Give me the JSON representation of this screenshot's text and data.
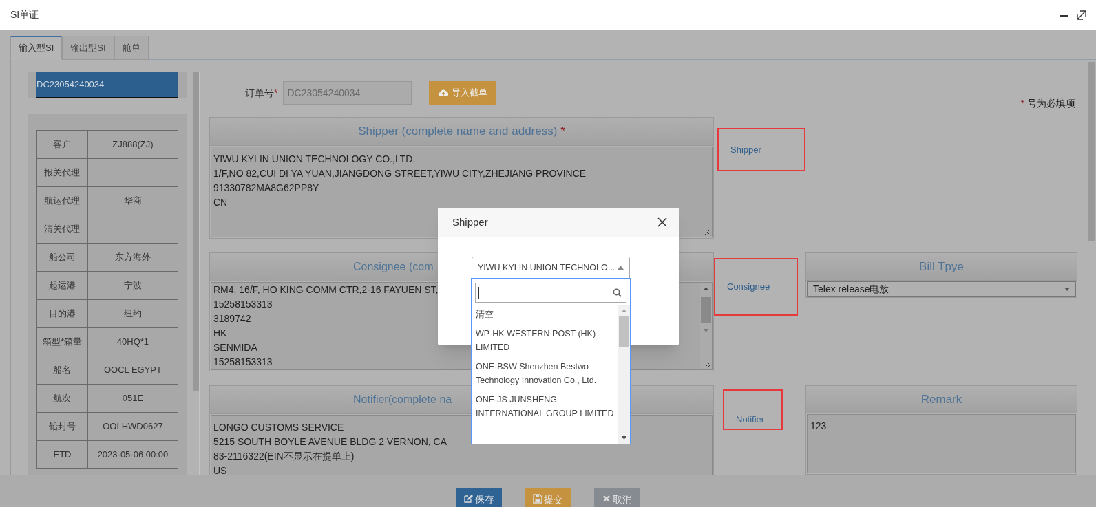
{
  "window": {
    "title": "SI单证"
  },
  "tabs": [
    {
      "label": "输入型SI",
      "selected": true
    },
    {
      "label": "输出型SI",
      "selected": false
    },
    {
      "label": "舱单",
      "selected": false
    }
  ],
  "order_list": [
    {
      "label": "DC23054240034",
      "selected": true
    }
  ],
  "info_table": {
    "rows": [
      {
        "label": "客户",
        "value": "ZJ888(ZJ)"
      },
      {
        "label": "报关代理"
      },
      {
        "label": "航运代理",
        "value": "华商"
      },
      {
        "label": "清关代理"
      },
      {
        "label": "船公司",
        "value": "东方海外"
      },
      {
        "label": "起运港",
        "value": "宁波"
      },
      {
        "label": "目的港",
        "value": "纽约"
      },
      {
        "label": "箱型*箱量",
        "value": "40HQ*1"
      },
      {
        "label": "船名",
        "value": "OOCL EGYPT"
      },
      {
        "label": "航次",
        "value": "051E"
      },
      {
        "label": "铅封号",
        "value": "OOLHWD0627"
      },
      {
        "label": "ETD",
        "value": "2023-05-06 00:00"
      }
    ]
  },
  "order_no": {
    "label": "订单号",
    "mark": "*",
    "value": "DC23054240034"
  },
  "import_button": {
    "label": "导入截单"
  },
  "required_note": {
    "mark": "*",
    "text": "号为必填项"
  },
  "sections": [
    {
      "title": "Shipper (complete name and address)",
      "mark": "*",
      "cut": false,
      "lines": [
        "YIWU KYLIN UNION TECHNOLOGY CO.,LTD.",
        "1/F,NO 82,CUI DI YA YUAN,JIANGDONG STREET,YIWU CITY,ZHEJIANG PROVINCE",
        "91330782MA8G62PP8Y",
        "CN"
      ],
      "scrollbar": false,
      "annotation": "Shipper"
    },
    {
      "title": "Consignee (com",
      "cut": true,
      "lines": [
        "RM4, 16/F, HO KING COMM CTR,2-16 FAYUEN ST,",
        "15258153313",
        "3189742",
        "HK",
        "SENMIDA",
        "15258153313"
      ],
      "scrollbar": true,
      "annotation": "Consignee"
    },
    {
      "title": "Notifier(complete na",
      "cut": true,
      "lines": [
        "LONGO CUSTOMS SERVICE",
        "5215 SOUTH BOYLE AVENUE BLDG 2 VERNON, CA",
        "83-2116322(EIN不显示在提单上)",
        "US"
      ],
      "scrollbar": false,
      "annotation": "Notifier"
    }
  ],
  "bill_type": {
    "title": "Bill Tpye",
    "value": "Telex release电放"
  },
  "remark": {
    "title": "Remark",
    "value": "123"
  },
  "footer_buttons": [
    {
      "label": "保存",
      "kind": "save"
    },
    {
      "label": "提交",
      "kind": "submit"
    },
    {
      "label": "取消",
      "kind": "cancel"
    }
  ],
  "dialog": {
    "title": "Shipper",
    "select": {
      "value": "YIWU KYLIN UNION TECHNOLO...",
      "expanded": true
    },
    "options": [
      {
        "label": "清空"
      },
      {
        "label": "WP-HK WESTERN POST (HK) LIMITED"
      },
      {
        "label": "ONE-BSW Shenzhen Bestwo Technology Innovation Co., Ltd."
      },
      {
        "label": "ONE-JS JUNSHENG INTERNATIONAL GROUP LIMITED"
      }
    ]
  }
}
